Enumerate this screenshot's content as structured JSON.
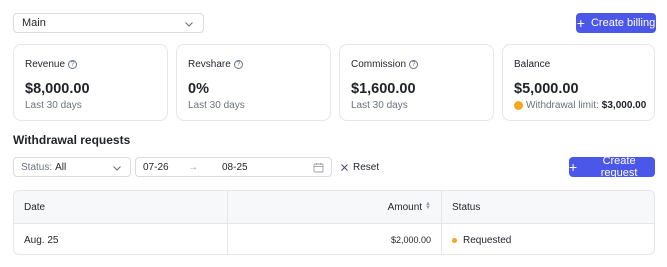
{
  "account_select": {
    "value": "Main"
  },
  "create_billing": {
    "label": "Create billing"
  },
  "cards": [
    {
      "title": "Revenue",
      "value": "$8,000.00",
      "sub": "Last 30 days"
    },
    {
      "title": "Revshare",
      "value": "0%",
      "sub": "Last 30 days"
    },
    {
      "title": "Commission",
      "value": "$1,600.00",
      "sub": "Last 30 days"
    },
    {
      "title": "Balance",
      "value": "$5,000.00",
      "sub_label": "Withdrawal limit:",
      "sub_value": "$3,000.00"
    }
  ],
  "section_title": "Withdrawal requests",
  "filters": {
    "status_label": "Status:",
    "status_value": "All",
    "date_from": "07-26",
    "date_arrow": "→",
    "date_to": "08-25",
    "reset_label": "Reset"
  },
  "create_request": {
    "label": "Create request"
  },
  "table": {
    "columns": [
      "Date",
      "Amount",
      "Status"
    ],
    "rows": [
      {
        "date": "Aug. 25",
        "amount": "$2,000.00",
        "status": "Requested"
      }
    ]
  },
  "colors": {
    "primary": "#4b57e8",
    "pending": "#f5a623"
  }
}
